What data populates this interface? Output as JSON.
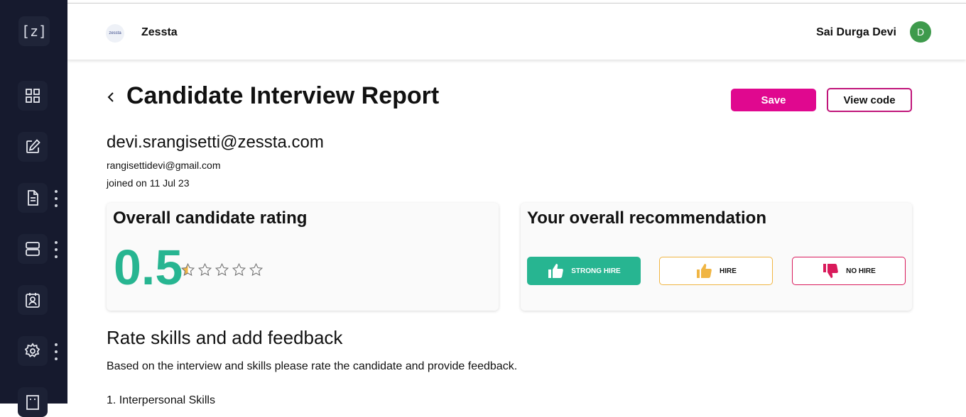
{
  "sidebar": {
    "logo": "[z]",
    "items": [
      {
        "icon": "dashboard-grid-icon"
      },
      {
        "icon": "edit-icon"
      },
      {
        "icon": "document-icon"
      },
      {
        "icon": "server-icon"
      },
      {
        "icon": "calendar-profile-icon"
      },
      {
        "icon": "settings-user-icon"
      },
      {
        "icon": "building-icon"
      }
    ]
  },
  "header": {
    "org_logo_text": "zessta",
    "org_name": "Zessta",
    "user_name": "Sai Durga Devi",
    "avatar_initial": "D"
  },
  "page": {
    "title": "Candidate Interview Report",
    "save_label": "Save",
    "view_code_label": "View code"
  },
  "candidate": {
    "email": "devi.srangisetti@zessta.com",
    "alt_email": "rangisettidevi@gmail.com",
    "joined": "joined on  11 Jul 23"
  },
  "rating": {
    "title": "Overall candidate rating",
    "value": "0.5",
    "score": 0.5,
    "max": 5
  },
  "recommendation": {
    "title": "Your overall recommendation",
    "strong_hire": "STRONG HIRE",
    "hire": "HIRE",
    "no_hire": "NO HIRE",
    "selected": "STRONG HIRE"
  },
  "skills": {
    "title": "Rate skills and add feedback",
    "description": "Based on the interview and skills please rate the candidate and provide feedback.",
    "first_item": "1. Interpersonal Skills"
  },
  "colors": {
    "sidebar": "#161a2e",
    "accent_pink": "#e0088f",
    "accent_green": "#27b591",
    "star_gold": "#f0b543",
    "no_hire_red": "#d91a5b"
  }
}
